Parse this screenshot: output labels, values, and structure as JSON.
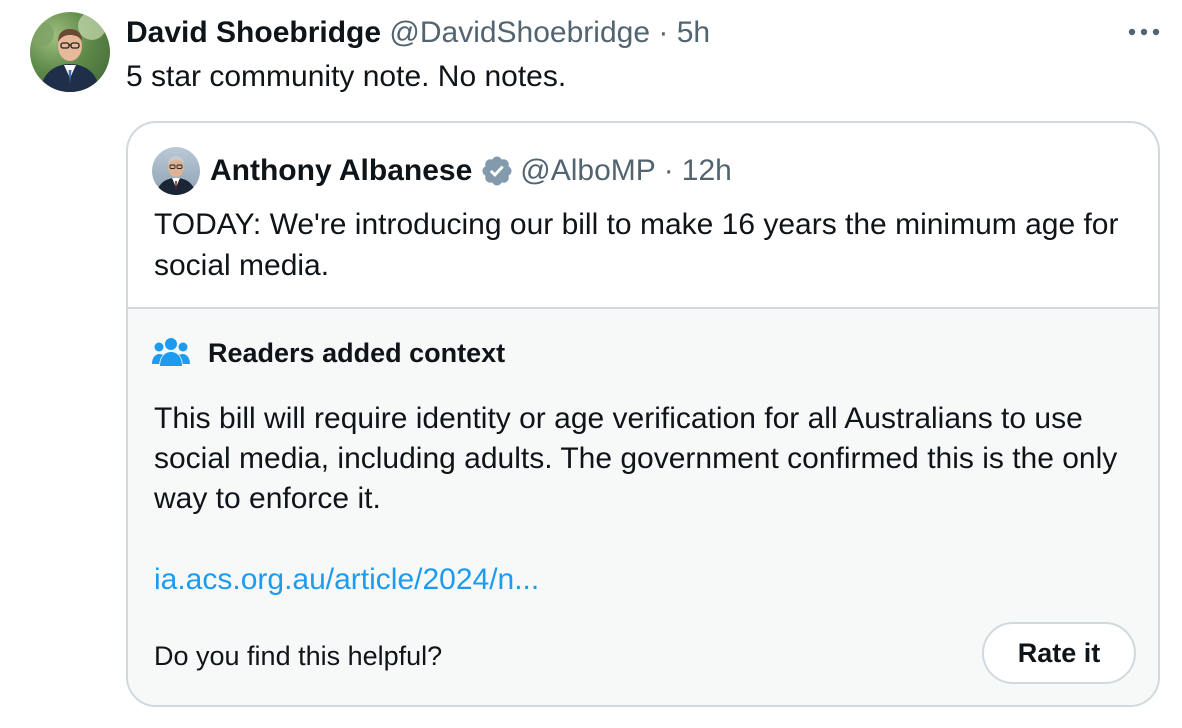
{
  "tweet": {
    "author_name": "David Shoebridge",
    "author_handle": "@DavidShoebridge",
    "separator": "·",
    "time": "5h",
    "text": "5 star community note. No notes.",
    "avatar_icon": "profile-photo",
    "more_icon": "more-options-icon"
  },
  "quoted": {
    "author_name": "Anthony Albanese",
    "author_handle": "@AlboMP",
    "separator": "·",
    "time": "12h",
    "verified_icon": "verified-badge-icon",
    "verified_color": "#829aab",
    "text": "TODAY: We're introducing our bill to make 16 years the minimum age for social media."
  },
  "note": {
    "icon": "people-icon",
    "icon_color": "#1d9bf0",
    "title": "Readers added context",
    "body": "This bill will require identity or age verification for all Australians to use social media, including adults. The government confirmed this is the only way to enforce it.",
    "link": "ia.acs.org.au/article/2024/n...",
    "helpful_prompt": "Do you find this helpful?",
    "rate_label": "Rate it"
  },
  "colors": {
    "text": "#0f1419",
    "secondary": "#536471",
    "border": "#cfd9de",
    "link": "#1d9bf0",
    "note_bg": "#f7f9f9"
  }
}
